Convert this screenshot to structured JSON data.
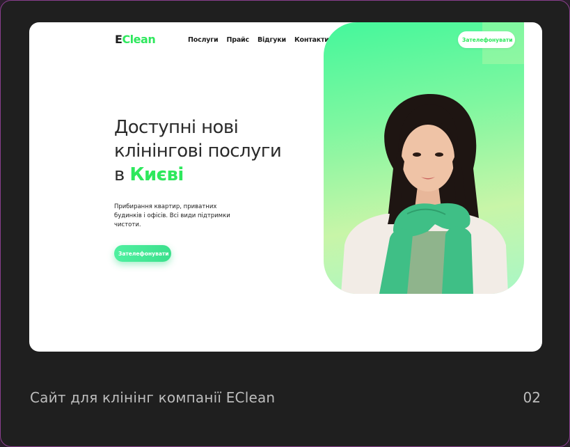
{
  "header": {
    "logo_main": "E",
    "logo_accent": "Clean",
    "nav": [
      "Послуги",
      "Прайс",
      "Відгуки",
      "Контакти"
    ],
    "call_button": "Зателефонувати"
  },
  "hero": {
    "title_line1": "Доступні нові",
    "title_line2": "клінінгові послуги",
    "title_prefix": "в ",
    "title_accent": "Києві",
    "description": "Прибирання квартир, приватних будинків і офісів. Всі види підтримки чистоти.",
    "cta_label": "Зателефонувати"
  },
  "footer": {
    "caption": "Сайт для клінінг компанії EClean",
    "page_number": "02"
  },
  "colors": {
    "accent": "#2ee85d",
    "panel_gradient_start": "#44f79b",
    "panel_gradient_end": "#a8f7c6",
    "gloves": "#3fbf86",
    "background": "#1f1f1f"
  }
}
